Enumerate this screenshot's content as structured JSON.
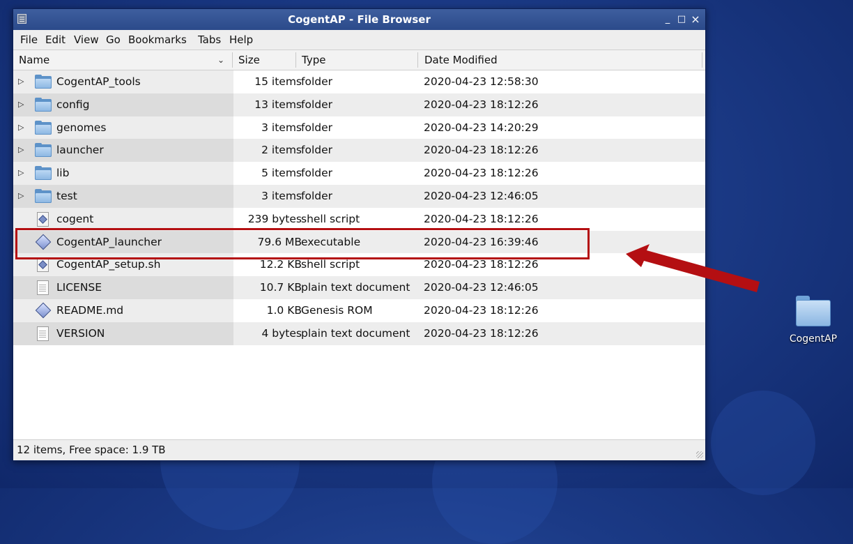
{
  "window": {
    "title": "CogentAP - File Browser",
    "minimize": "_",
    "maximize": "□",
    "close": "×"
  },
  "menu": [
    "File",
    "Edit",
    "View",
    "Go",
    "Bookmarks",
    "Tabs",
    "Help"
  ],
  "columns": {
    "name": "Name",
    "size": "Size",
    "type": "Type",
    "date": "Date Modified"
  },
  "rows": [
    {
      "name": "CogentAP_tools",
      "size": "15 items",
      "type": "folder",
      "date": "2020-04-23 12:58:30",
      "icon": "folder-icon",
      "expandable": true
    },
    {
      "name": "config",
      "size": "13 items",
      "type": "folder",
      "date": "2020-04-23 18:12:26",
      "icon": "folder-icon",
      "expandable": true
    },
    {
      "name": "genomes",
      "size": "3 items",
      "type": "folder",
      "date": "2020-04-23 14:20:29",
      "icon": "folder-icon",
      "expandable": true
    },
    {
      "name": "launcher",
      "size": "2 items",
      "type": "folder",
      "date": "2020-04-23 18:12:26",
      "icon": "folder-icon",
      "expandable": true
    },
    {
      "name": "lib",
      "size": "5 items",
      "type": "folder",
      "date": "2020-04-23 18:12:26",
      "icon": "folder-icon",
      "expandable": true
    },
    {
      "name": "test",
      "size": "3 items",
      "type": "folder",
      "date": "2020-04-23 12:46:05",
      "icon": "folder-icon",
      "expandable": true
    },
    {
      "name": "cogent",
      "size": "239 bytes",
      "type": "shell script",
      "date": "2020-04-23 18:12:26",
      "icon": "script-icon",
      "expandable": false
    },
    {
      "name": "CogentAP_launcher",
      "size": "79.6 MB",
      "type": "executable",
      "date": "2020-04-23 16:39:46",
      "icon": "executable-icon",
      "expandable": false
    },
    {
      "name": "CogentAP_setup.sh",
      "size": "12.2 KB",
      "type": "shell script",
      "date": "2020-04-23 18:12:26",
      "icon": "script-icon",
      "expandable": false
    },
    {
      "name": "LICENSE",
      "size": "10.7 KB",
      "type": "plain text document",
      "date": "2020-04-23 12:46:05",
      "icon": "document-icon",
      "expandable": false
    },
    {
      "name": "README.md",
      "size": "1.0 KB",
      "type": "Genesis ROM",
      "date": "2020-04-23 18:12:26",
      "icon": "executable-icon",
      "expandable": false
    },
    {
      "name": "VERSION",
      "size": "4 bytes",
      "type": "plain text document",
      "date": "2020-04-23 18:12:26",
      "icon": "document-icon",
      "expandable": false
    }
  ],
  "status": "12 items, Free space: 1.9 TB",
  "desktop_icon": {
    "label": "CogentAP",
    "icon": "folder-icon"
  },
  "annotation": {
    "highlight_color": "#b40f12",
    "arrow_color": "#b40f12"
  },
  "expander_glyph": "▷",
  "sort_glyph": "⌄"
}
